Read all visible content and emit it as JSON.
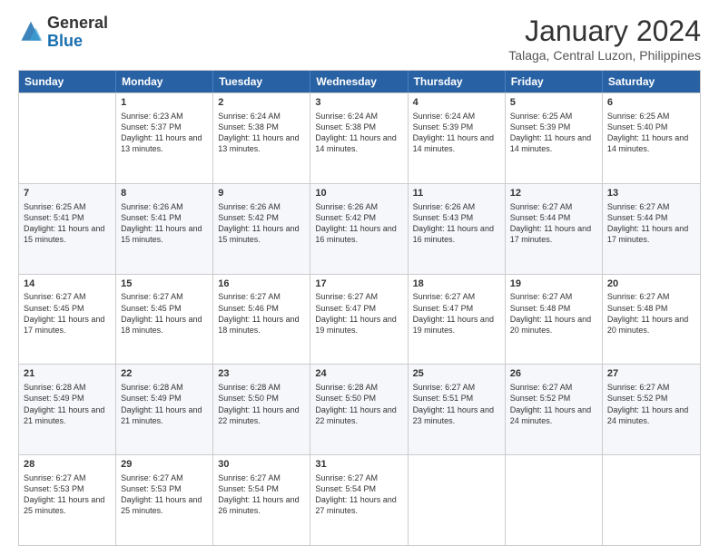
{
  "logo": {
    "general": "General",
    "blue": "Blue"
  },
  "title": "January 2024",
  "subtitle": "Talaga, Central Luzon, Philippines",
  "days": [
    "Sunday",
    "Monday",
    "Tuesday",
    "Wednesday",
    "Thursday",
    "Friday",
    "Saturday"
  ],
  "weeks": [
    [
      {
        "day": "",
        "sunrise": "",
        "sunset": "",
        "daylight": ""
      },
      {
        "day": "1",
        "sunrise": "Sunrise: 6:23 AM",
        "sunset": "Sunset: 5:37 PM",
        "daylight": "Daylight: 11 hours and 13 minutes."
      },
      {
        "day": "2",
        "sunrise": "Sunrise: 6:24 AM",
        "sunset": "Sunset: 5:38 PM",
        "daylight": "Daylight: 11 hours and 13 minutes."
      },
      {
        "day": "3",
        "sunrise": "Sunrise: 6:24 AM",
        "sunset": "Sunset: 5:38 PM",
        "daylight": "Daylight: 11 hours and 14 minutes."
      },
      {
        "day": "4",
        "sunrise": "Sunrise: 6:24 AM",
        "sunset": "Sunset: 5:39 PM",
        "daylight": "Daylight: 11 hours and 14 minutes."
      },
      {
        "day": "5",
        "sunrise": "Sunrise: 6:25 AM",
        "sunset": "Sunset: 5:39 PM",
        "daylight": "Daylight: 11 hours and 14 minutes."
      },
      {
        "day": "6",
        "sunrise": "Sunrise: 6:25 AM",
        "sunset": "Sunset: 5:40 PM",
        "daylight": "Daylight: 11 hours and 14 minutes."
      }
    ],
    [
      {
        "day": "7",
        "sunrise": "Sunrise: 6:25 AM",
        "sunset": "Sunset: 5:41 PM",
        "daylight": "Daylight: 11 hours and 15 minutes."
      },
      {
        "day": "8",
        "sunrise": "Sunrise: 6:26 AM",
        "sunset": "Sunset: 5:41 PM",
        "daylight": "Daylight: 11 hours and 15 minutes."
      },
      {
        "day": "9",
        "sunrise": "Sunrise: 6:26 AM",
        "sunset": "Sunset: 5:42 PM",
        "daylight": "Daylight: 11 hours and 15 minutes."
      },
      {
        "day": "10",
        "sunrise": "Sunrise: 6:26 AM",
        "sunset": "Sunset: 5:42 PM",
        "daylight": "Daylight: 11 hours and 16 minutes."
      },
      {
        "day": "11",
        "sunrise": "Sunrise: 6:26 AM",
        "sunset": "Sunset: 5:43 PM",
        "daylight": "Daylight: 11 hours and 16 minutes."
      },
      {
        "day": "12",
        "sunrise": "Sunrise: 6:27 AM",
        "sunset": "Sunset: 5:44 PM",
        "daylight": "Daylight: 11 hours and 17 minutes."
      },
      {
        "day": "13",
        "sunrise": "Sunrise: 6:27 AM",
        "sunset": "Sunset: 5:44 PM",
        "daylight": "Daylight: 11 hours and 17 minutes."
      }
    ],
    [
      {
        "day": "14",
        "sunrise": "Sunrise: 6:27 AM",
        "sunset": "Sunset: 5:45 PM",
        "daylight": "Daylight: 11 hours and 17 minutes."
      },
      {
        "day": "15",
        "sunrise": "Sunrise: 6:27 AM",
        "sunset": "Sunset: 5:45 PM",
        "daylight": "Daylight: 11 hours and 18 minutes."
      },
      {
        "day": "16",
        "sunrise": "Sunrise: 6:27 AM",
        "sunset": "Sunset: 5:46 PM",
        "daylight": "Daylight: 11 hours and 18 minutes."
      },
      {
        "day": "17",
        "sunrise": "Sunrise: 6:27 AM",
        "sunset": "Sunset: 5:47 PM",
        "daylight": "Daylight: 11 hours and 19 minutes."
      },
      {
        "day": "18",
        "sunrise": "Sunrise: 6:27 AM",
        "sunset": "Sunset: 5:47 PM",
        "daylight": "Daylight: 11 hours and 19 minutes."
      },
      {
        "day": "19",
        "sunrise": "Sunrise: 6:27 AM",
        "sunset": "Sunset: 5:48 PM",
        "daylight": "Daylight: 11 hours and 20 minutes."
      },
      {
        "day": "20",
        "sunrise": "Sunrise: 6:27 AM",
        "sunset": "Sunset: 5:48 PM",
        "daylight": "Daylight: 11 hours and 20 minutes."
      }
    ],
    [
      {
        "day": "21",
        "sunrise": "Sunrise: 6:28 AM",
        "sunset": "Sunset: 5:49 PM",
        "daylight": "Daylight: 11 hours and 21 minutes."
      },
      {
        "day": "22",
        "sunrise": "Sunrise: 6:28 AM",
        "sunset": "Sunset: 5:49 PM",
        "daylight": "Daylight: 11 hours and 21 minutes."
      },
      {
        "day": "23",
        "sunrise": "Sunrise: 6:28 AM",
        "sunset": "Sunset: 5:50 PM",
        "daylight": "Daylight: 11 hours and 22 minutes."
      },
      {
        "day": "24",
        "sunrise": "Sunrise: 6:28 AM",
        "sunset": "Sunset: 5:50 PM",
        "daylight": "Daylight: 11 hours and 22 minutes."
      },
      {
        "day": "25",
        "sunrise": "Sunrise: 6:27 AM",
        "sunset": "Sunset: 5:51 PM",
        "daylight": "Daylight: 11 hours and 23 minutes."
      },
      {
        "day": "26",
        "sunrise": "Sunrise: 6:27 AM",
        "sunset": "Sunset: 5:52 PM",
        "daylight": "Daylight: 11 hours and 24 minutes."
      },
      {
        "day": "27",
        "sunrise": "Sunrise: 6:27 AM",
        "sunset": "Sunset: 5:52 PM",
        "daylight": "Daylight: 11 hours and 24 minutes."
      }
    ],
    [
      {
        "day": "28",
        "sunrise": "Sunrise: 6:27 AM",
        "sunset": "Sunset: 5:53 PM",
        "daylight": "Daylight: 11 hours and 25 minutes."
      },
      {
        "day": "29",
        "sunrise": "Sunrise: 6:27 AM",
        "sunset": "Sunset: 5:53 PM",
        "daylight": "Daylight: 11 hours and 25 minutes."
      },
      {
        "day": "30",
        "sunrise": "Sunrise: 6:27 AM",
        "sunset": "Sunset: 5:54 PM",
        "daylight": "Daylight: 11 hours and 26 minutes."
      },
      {
        "day": "31",
        "sunrise": "Sunrise: 6:27 AM",
        "sunset": "Sunset: 5:54 PM",
        "daylight": "Daylight: 11 hours and 27 minutes."
      },
      {
        "day": "",
        "sunrise": "",
        "sunset": "",
        "daylight": ""
      },
      {
        "day": "",
        "sunrise": "",
        "sunset": "",
        "daylight": ""
      },
      {
        "day": "",
        "sunrise": "",
        "sunset": "",
        "daylight": ""
      }
    ]
  ]
}
